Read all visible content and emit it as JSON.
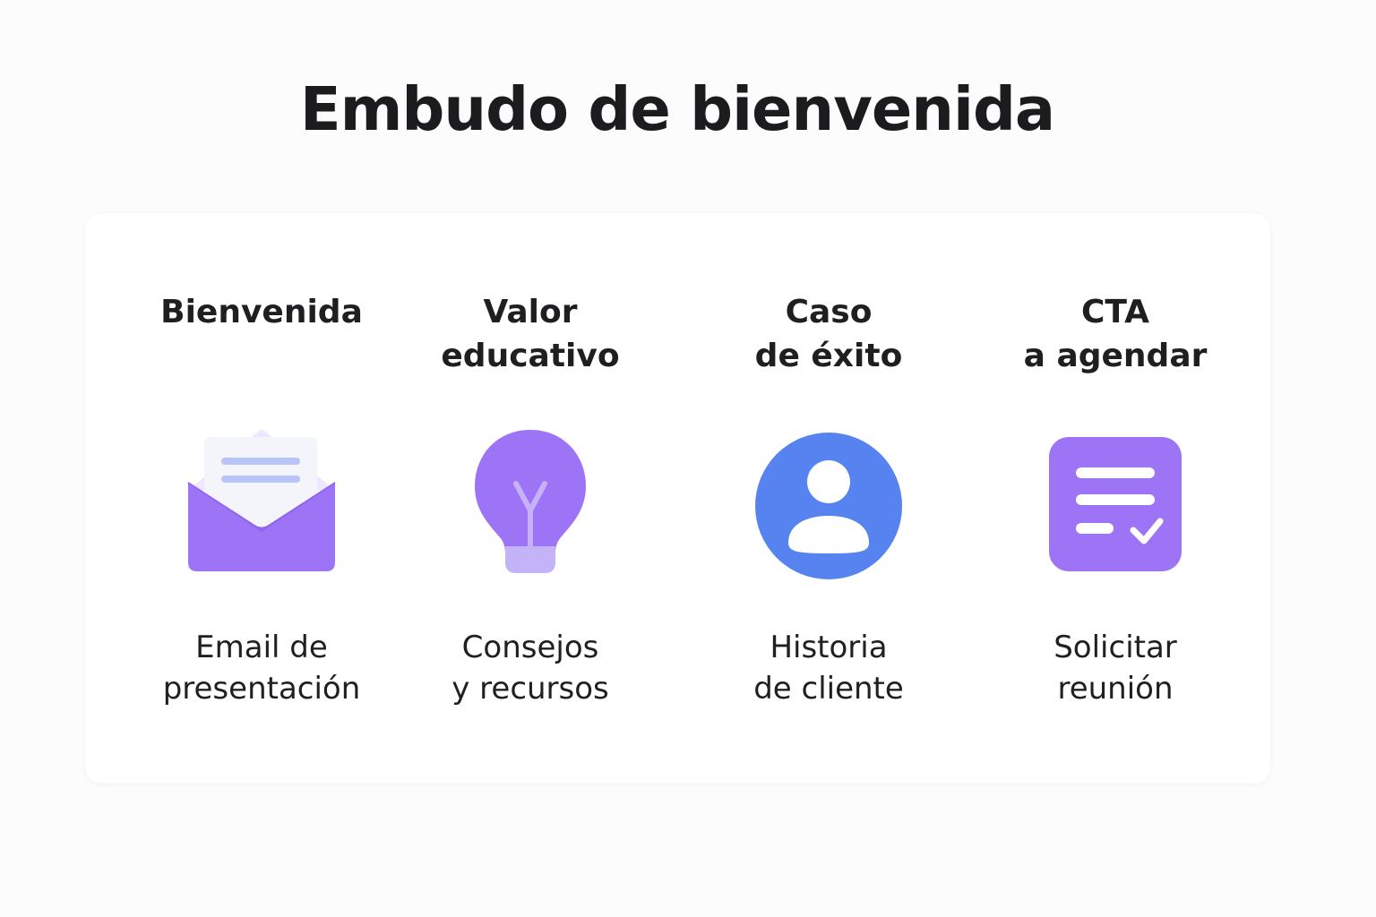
{
  "title": "Embudo de bienvenida",
  "steps": [
    {
      "title_lines": [
        "Bienvenida",
        ""
      ],
      "icon": "envelope-open-icon",
      "desc_lines": [
        "Email de",
        "presentación"
      ],
      "color": "#9d74f5"
    },
    {
      "title_lines": [
        "Valor",
        "educativo"
      ],
      "icon": "lightbulb-icon",
      "desc_lines": [
        "Consejos",
        "y recursos"
      ],
      "color": "#9d74f5"
    },
    {
      "title_lines": [
        "Caso",
        "de éxito"
      ],
      "icon": "user-circle-icon",
      "desc_lines": [
        "Historia",
        "de cliente"
      ],
      "color": "#5683ef"
    },
    {
      "title_lines": [
        "CTA",
        "a agendar"
      ],
      "icon": "checklist-icon",
      "desc_lines": [
        "Solicitar",
        "reunión"
      ],
      "color": "#9d74f5"
    }
  ]
}
